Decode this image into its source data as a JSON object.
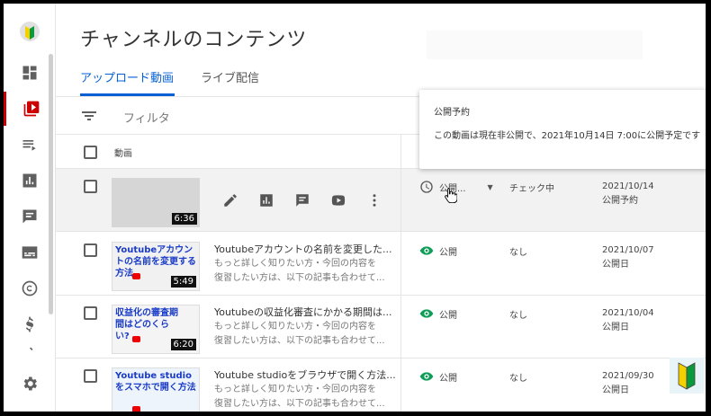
{
  "page": {
    "title": "チャンネルのコンテンツ"
  },
  "tabs": [
    {
      "label": "アップロード動画",
      "active": true
    },
    {
      "label": "ライブ配信",
      "active": false
    }
  ],
  "filter": {
    "label": "フィルタ"
  },
  "table": {
    "col_video": "動画"
  },
  "tooltip": {
    "title": "公開予約",
    "body": "この動画は現在非公開で、2021年10月14日 7:00に公開予定です"
  },
  "rows": [
    {
      "duration": "6:36",
      "visibility": "公開...",
      "restriction": "チェック中",
      "date": "2021/10/14",
      "date_label": "公開予約"
    },
    {
      "thumb_text": "Youtubeアカウントの名前を変更する方法",
      "duration": "5:49",
      "title": "Youtubeアカウントの名前を変更した...",
      "desc1": "もっと詳しく知りたい方・今回の内容を",
      "desc2": "復習したい方は、以下の記事も合わせて...",
      "visibility": "公開",
      "restriction": "なし",
      "date": "2021/10/07",
      "date_label": "公開日"
    },
    {
      "thumb_text": "収益化の審査期間はどのくらい?",
      "duration": "6:20",
      "title": "Youtubeの収益化審査にかかる期間は...",
      "desc1": "もっと詳しく知りたい方・今回の内容を",
      "desc2": "復習したい方は、以下の記事も合わせて...",
      "visibility": "公開",
      "restriction": "なし",
      "date": "2021/10/04",
      "date_label": "公開日"
    },
    {
      "thumb_text": "Youtube studioをスマホで開く方法",
      "title": "Youtube studioをブラウザで開く方法...",
      "desc1": "もっと詳しく知りたい方・今回の内容を",
      "desc2": "復習したい方は、以下の記事も合わせて...",
      "visibility": "公開",
      "restriction": "なし",
      "date": "2021/09/30",
      "date_label": "公開日"
    }
  ],
  "colors": {
    "accent": "#065fd4",
    "active_rail": "#cc0000",
    "public_icon": "#0f9d58"
  },
  "rail_icons": [
    "beginner-mark-icon",
    "dashboard-icon",
    "content-icon",
    "playlist-icon",
    "analytics-icon",
    "comments-icon",
    "subtitles-icon",
    "copyright-icon",
    "monetization-icon",
    "customization-icon",
    "settings-icon"
  ]
}
